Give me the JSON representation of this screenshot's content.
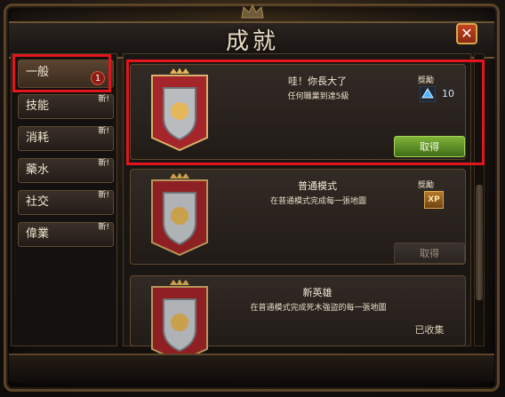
{
  "window": {
    "title": "成就"
  },
  "tabs": [
    {
      "label": "一般",
      "new": "",
      "badge": "1"
    },
    {
      "label": "技能",
      "new": "新!"
    },
    {
      "label": "消耗",
      "new": "新!"
    },
    {
      "label": "藥水",
      "new": "新!"
    },
    {
      "label": "社交",
      "new": "新!"
    },
    {
      "label": "偉業",
      "new": "新!"
    }
  ],
  "achievements": [
    {
      "title": "哇！你長大了",
      "desc": "任何職業到達5級",
      "reward_label": "獎勵",
      "reward_value": "10",
      "button": "取得",
      "button_state": "enabled"
    },
    {
      "title": "普通模式",
      "desc": "在普通模式完成每一張地圖",
      "reward_label": "獎勵",
      "reward_icon": "XP",
      "button": "取得",
      "button_state": "disabled"
    },
    {
      "title": "新英雄",
      "desc": "在普通模式完成死木強盜的每一張地圖",
      "button": "已收集"
    }
  ],
  "colors": {
    "highlight_red": "#e2141c",
    "button_green": "#5e9a2a",
    "frame_gold": "#6b5431"
  }
}
